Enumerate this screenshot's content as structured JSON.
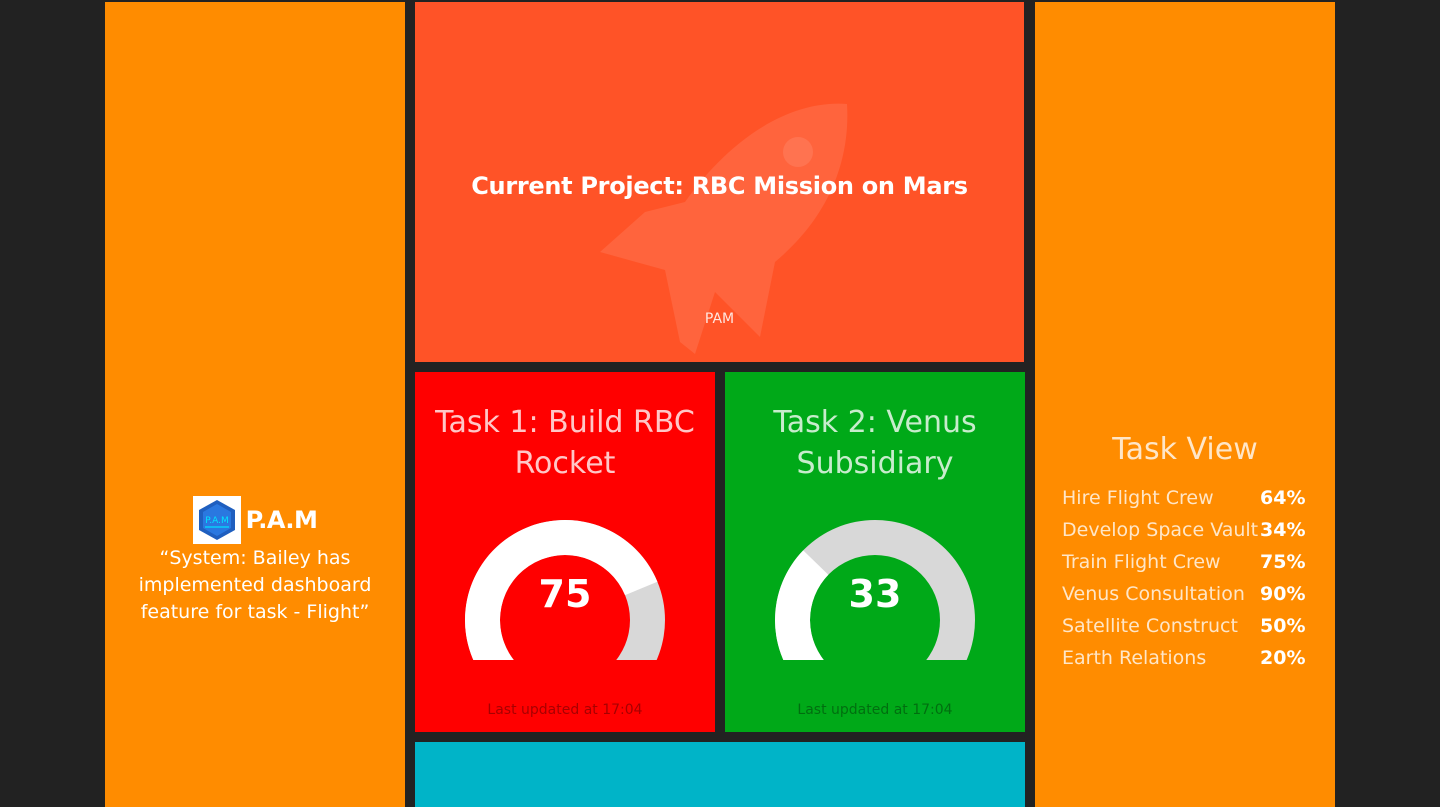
{
  "colors": {
    "background": "#222222",
    "orange": "#ff8c00",
    "project": "#ff5327",
    "task1": "#ff0000",
    "task2": "#00a918",
    "cyan": "#00b4c8",
    "gauge_track": "#d8d8d8",
    "gauge_fill": "#ffffff"
  },
  "notification": {
    "logo_text": "P.A.M",
    "logo_icon": "pam-hexagon-logo",
    "name": "P.A.M",
    "message": "“System: Bailey has implemented dashboard feature for task - Flight”"
  },
  "project": {
    "title": "Current Project: RBC Mission on Mars",
    "footer": "PAM",
    "icon": "rocket-icon"
  },
  "tasks": [
    {
      "title": "Task 1: Build RBC Rocket",
      "value": 75,
      "display_value": "75",
      "max": 100,
      "updated": "Last updated at 17:04"
    },
    {
      "title": "Task 2: Venus Subsidiary",
      "value": 33,
      "display_value": "33",
      "max": 100,
      "updated": "Last updated at 17:04"
    }
  ],
  "task_view": {
    "title": "Task View",
    "items": [
      {
        "name": "Hire Flight Crew",
        "percent": "64%"
      },
      {
        "name": "Develop Space Vault",
        "percent": "34%"
      },
      {
        "name": "Train Flight Crew",
        "percent": "75%"
      },
      {
        "name": "Venus Consultation",
        "percent": "90%"
      },
      {
        "name": "Satellite Construct",
        "percent": "50%"
      },
      {
        "name": "Earth Relations",
        "percent": "20%"
      }
    ]
  }
}
